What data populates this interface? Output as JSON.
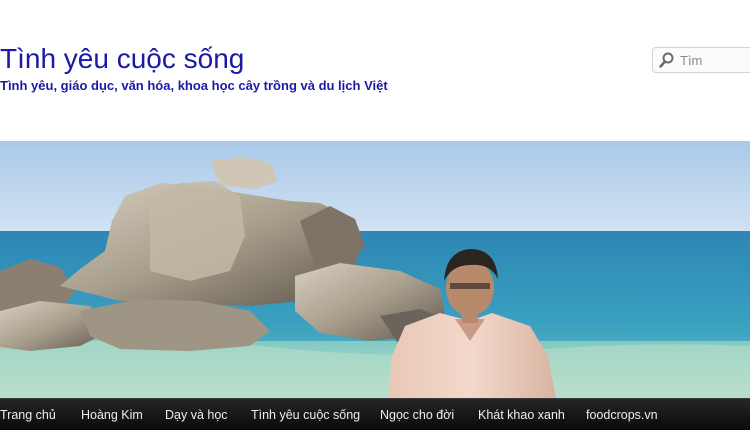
{
  "header": {
    "title": "Tình yêu cuộc sống",
    "description": "Tình yêu, giáo dục, văn hóa, khoa học cây trồng và du lịch Việt"
  },
  "search": {
    "placeholder": "Tìm",
    "icon": "search-icon"
  },
  "banner": {
    "description_hidden": ""
  },
  "nav": {
    "items": [
      {
        "label": "Trang chủ"
      },
      {
        "label": "Hoàng Kim"
      },
      {
        "label": "Dạy và học"
      },
      {
        "label": "Tình yêu cuộc sống"
      },
      {
        "label": "Ngọc cho đời"
      },
      {
        "label": "Khát khao xanh"
      },
      {
        "label": "foodcrops.vn"
      }
    ]
  },
  "colors": {
    "title": "#1a1aa6",
    "nav_bg": "#1a1a1a",
    "nav_text": "#eeeeee"
  }
}
